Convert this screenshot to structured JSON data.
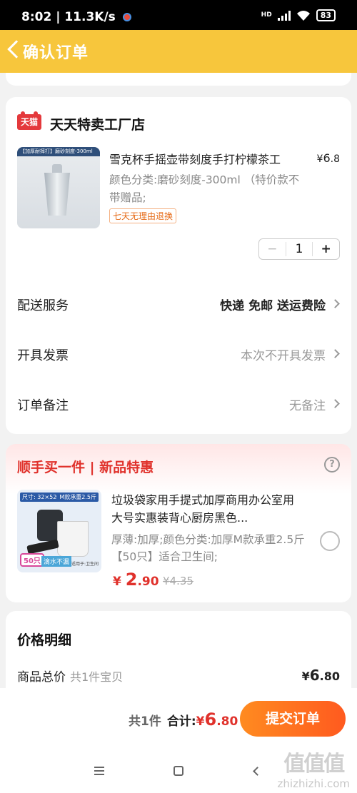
{
  "status_bar": {
    "time": "8:02",
    "speed": "11.3K/s",
    "network": "HD",
    "battery": "83"
  },
  "header": {
    "title": "确认订单"
  },
  "order": {
    "shop_name": "天天特卖工厂店",
    "shop_logo_text": "天猫",
    "product": {
      "image_band": "【加厚耐摔打】磨砂刻度-300ml",
      "title": "雪克杯手摇壶带刻度手打柠檬茶工",
      "price_symbol": "¥",
      "price_int": "6",
      "price_dec": ".8",
      "spec": "颜色分类:磨砂刻度-300ml （特价款不带赠品;",
      "return_tag": "七天无理由退换",
      "quantity": "1",
      "minus": "−",
      "plus": "+"
    },
    "delivery": {
      "label": "配送服务",
      "value": "快递 免邮 送运费险"
    },
    "invoice": {
      "label": "开具发票",
      "value": "本次不开具发票"
    },
    "remark": {
      "label": "订单备注",
      "value": "无备注"
    }
  },
  "recommend": {
    "title": "顺手买一件 | 新品特惠",
    "help": "?",
    "image_labels": {
      "size": "尺寸: 32×52CM",
      "load": "M款承重2.5斤",
      "count": "50只",
      "leak": "滴水不漏",
      "use": "适用于:卫生间"
    },
    "product_title": "垃圾袋家用手提式加厚商用办公室用大号实惠装背心厨房黑色...",
    "spec": "厚薄:加厚;颜色分类:加厚M款承重2.5斤【50只】适合卫生间;",
    "price_symbol": "¥",
    "price_int": "2",
    "price_dec": ".90",
    "old_price": "¥4.35"
  },
  "price_detail": {
    "title": "价格明细",
    "total_label": "商品总价",
    "total_count": "共1件宝贝",
    "total_symbol": "¥",
    "total_int": "6",
    "total_dec": ".80"
  },
  "bottom": {
    "count": "共1件",
    "sum_label": "合计:",
    "sum_symbol": "¥",
    "sum_int": "6",
    "sum_dec": ".80",
    "submit": "提交订单"
  },
  "watermark": {
    "logo": "值值值",
    "url": "zhizhizhi.com"
  },
  "colors": {
    "header": "#f7c63c",
    "accent_red": "#e0312b",
    "submit_start": "#ff8b20",
    "submit_end": "#ff5a1f"
  }
}
